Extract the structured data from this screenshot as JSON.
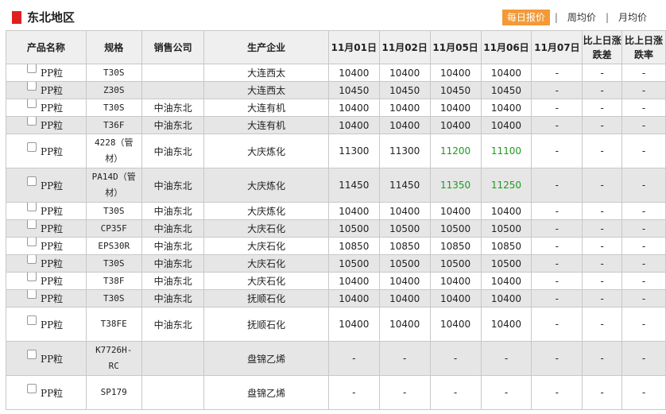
{
  "header": {
    "title": "东北地区",
    "tabs": [
      {
        "label": "每日报价",
        "active": true
      },
      {
        "label": "周均价",
        "active": false
      },
      {
        "label": "月均价",
        "active": false
      }
    ],
    "separator": "|",
    "accent_color": "#f39a37",
    "marker_color": "#e02020"
  },
  "table": {
    "columns": [
      "产品名称",
      "规格",
      "销售公司",
      "生产企业",
      "11月01日",
      "11月02日",
      "11月05日",
      "11月06日",
      "11月07日",
      "比上日涨跌差",
      "比上日涨跌率"
    ],
    "rows": [
      {
        "product": "PP粒",
        "spec": "T30S",
        "seller": "",
        "producer": "大连西太",
        "d1": "10400",
        "d2": "10400",
        "d5": "10400",
        "d6": "10400",
        "d7": "-",
        "diff": "-",
        "rate": "-"
      },
      {
        "product": "PP粒",
        "spec": "Z30S",
        "seller": "",
        "producer": "大连西太",
        "d1": "10450",
        "d2": "10450",
        "d5": "10450",
        "d6": "10450",
        "d7": "-",
        "diff": "-",
        "rate": "-"
      },
      {
        "product": "PP粒",
        "spec": "T30S",
        "seller": "中油东北",
        "producer": "大连有机",
        "d1": "10400",
        "d2": "10400",
        "d5": "10400",
        "d6": "10400",
        "d7": "-",
        "diff": "-",
        "rate": "-"
      },
      {
        "product": "PP粒",
        "spec": "T36F",
        "seller": "中油东北",
        "producer": "大连有机",
        "d1": "10400",
        "d2": "10400",
        "d5": "10400",
        "d6": "10400",
        "d7": "-",
        "diff": "-",
        "rate": "-"
      },
      {
        "product": "PP粒",
        "spec": "4228（管材）",
        "seller": "中油东北",
        "producer": "大庆炼化",
        "d1": "11300",
        "d2": "11300",
        "d5": "11200",
        "d6": "11100",
        "d7": "-",
        "diff": "-",
        "rate": "-",
        "green": true
      },
      {
        "product": "PP粒",
        "spec": "PA14D（管材）",
        "seller": "中油东北",
        "producer": "大庆炼化",
        "d1": "11450",
        "d2": "11450",
        "d5": "11350",
        "d6": "11250",
        "d7": "-",
        "diff": "-",
        "rate": "-",
        "green": true
      },
      {
        "product": "PP粒",
        "spec": "T30S",
        "seller": "中油东北",
        "producer": "大庆炼化",
        "d1": "10400",
        "d2": "10400",
        "d5": "10400",
        "d6": "10400",
        "d7": "-",
        "diff": "-",
        "rate": "-"
      },
      {
        "product": "PP粒",
        "spec": "CP35F",
        "seller": "中油东北",
        "producer": "大庆石化",
        "d1": "10500",
        "d2": "10500",
        "d5": "10500",
        "d6": "10500",
        "d7": "-",
        "diff": "-",
        "rate": "-"
      },
      {
        "product": "PP粒",
        "spec": "EPS30R",
        "seller": "中油东北",
        "producer": "大庆石化",
        "d1": "10850",
        "d2": "10850",
        "d5": "10850",
        "d6": "10850",
        "d7": "-",
        "diff": "-",
        "rate": "-"
      },
      {
        "product": "PP粒",
        "spec": "T30S",
        "seller": "中油东北",
        "producer": "大庆石化",
        "d1": "10500",
        "d2": "10500",
        "d5": "10500",
        "d6": "10500",
        "d7": "-",
        "diff": "-",
        "rate": "-"
      },
      {
        "product": "PP粒",
        "spec": "T38F",
        "seller": "中油东北",
        "producer": "大庆石化",
        "d1": "10400",
        "d2": "10400",
        "d5": "10400",
        "d6": "10400",
        "d7": "-",
        "diff": "-",
        "rate": "-"
      },
      {
        "product": "PP粒",
        "spec": "T30S",
        "seller": "中油东北",
        "producer": "抚顺石化",
        "d1": "10400",
        "d2": "10400",
        "d5": "10400",
        "d6": "10400",
        "d7": "-",
        "diff": "-",
        "rate": "-"
      },
      {
        "product": "PP粒",
        "spec": "T38FE",
        "seller": "中油东北",
        "producer": "抚顺石化",
        "d1": "10400",
        "d2": "10400",
        "d5": "10400",
        "d6": "10400",
        "d7": "-",
        "diff": "-",
        "rate": "-"
      },
      {
        "product": "PP粒",
        "spec": "K7726H-RC",
        "seller": "",
        "producer": "盘锦乙烯",
        "d1": "-",
        "d2": "-",
        "d5": "-",
        "d6": "-",
        "d7": "-",
        "diff": "-",
        "rate": "-"
      },
      {
        "product": "PP粒",
        "spec": "SP179",
        "seller": "",
        "producer": "盘锦乙烯",
        "d1": "-",
        "d2": "-",
        "d5": "-",
        "d6": "-",
        "d7": "-",
        "diff": "-",
        "rate": "-"
      }
    ]
  }
}
